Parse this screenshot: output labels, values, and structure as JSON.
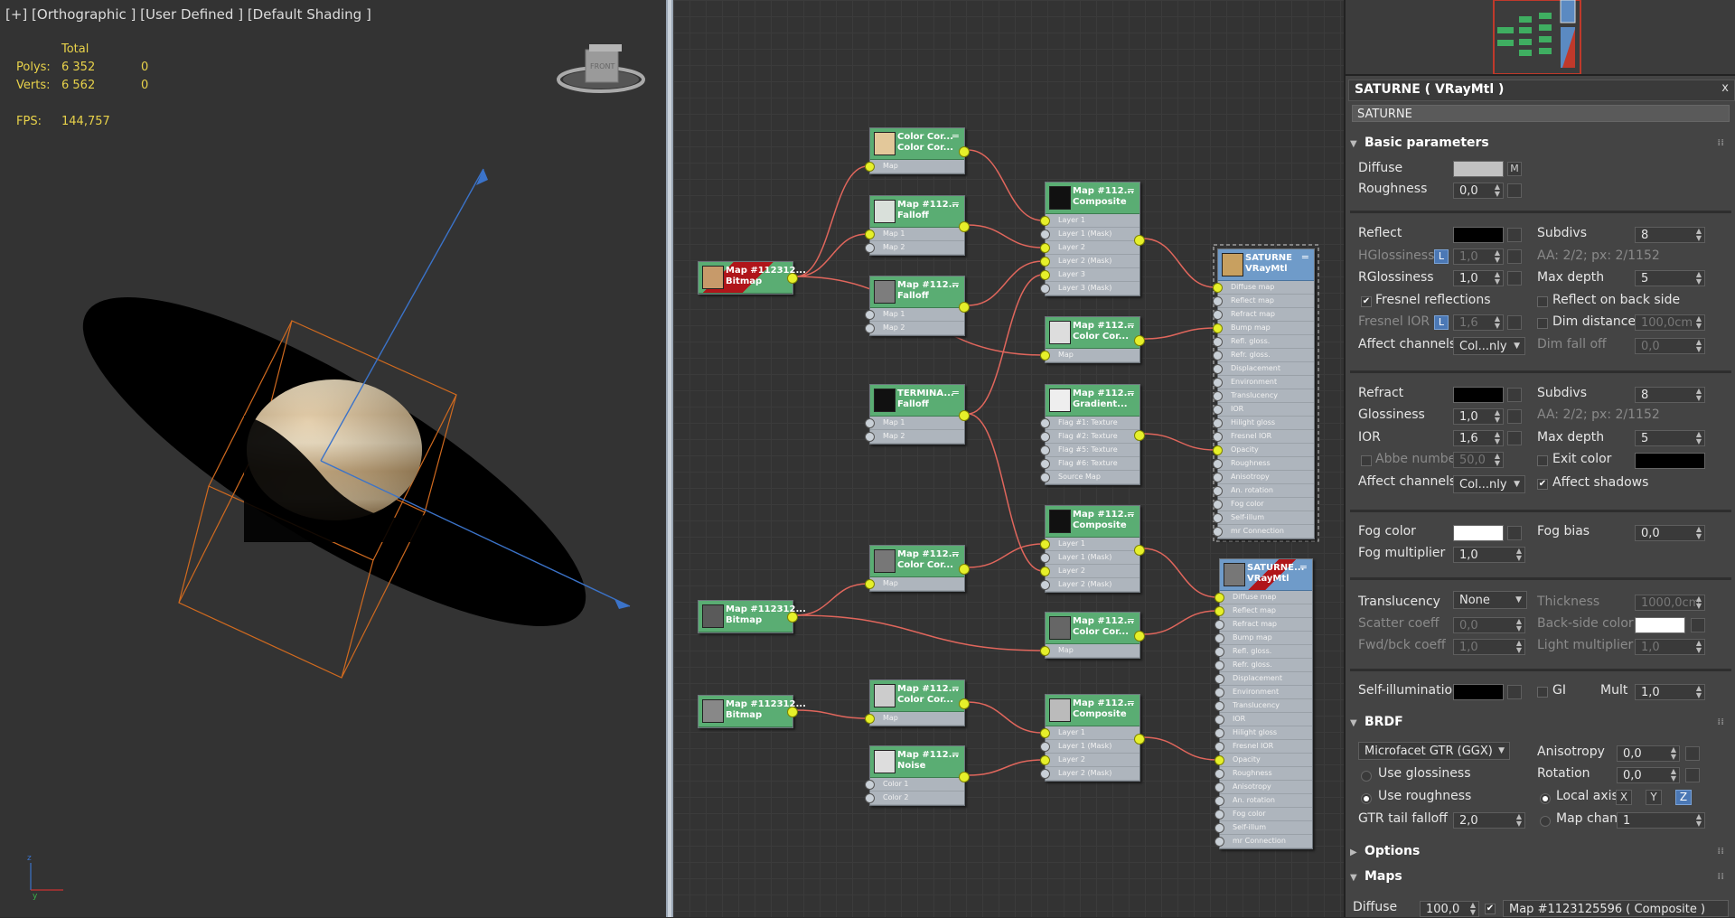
{
  "viewport": {
    "header": "[+] [Orthographic ] [User Defined ] [Default Shading ]",
    "stats": {
      "total_label": "Total",
      "polys_label": "Polys:",
      "polys_total": "6 352",
      "polys_sel": "0",
      "verts_label": "Verts:",
      "verts_total": "6 562",
      "verts_sel": "0",
      "fps_label": "FPS:",
      "fps_value": "144,757"
    },
    "viewcube_label": "FRONT"
  },
  "slate": {
    "nodes": [
      {
        "id": "n1",
        "t1": "Map #112312...",
        "t2": "Bitmap",
        "thumb": "#c79a6a",
        "red": true,
        "rows": []
      },
      {
        "id": "n2",
        "t1": "Map #112312...",
        "t2": "Bitmap",
        "thumb": "#5a5a5a",
        "rows": []
      },
      {
        "id": "n3",
        "t1": "Map #112312...",
        "t2": "Bitmap",
        "thumb": "#888",
        "rows": []
      },
      {
        "id": "n4",
        "t1": "Color Cor...",
        "t2": "Color Cor...",
        "thumb": "#e3c89a",
        "rows": [
          "Map"
        ]
      },
      {
        "id": "n5",
        "t1": "Map #112...",
        "t2": "Falloff",
        "thumb": "#d9e0da",
        "rows": [
          "Map 1",
          "Map 2"
        ]
      },
      {
        "id": "n6",
        "t1": "Map #112...",
        "t2": "Falloff",
        "thumb": "#7d7d7d",
        "rows": [
          "Map 1",
          "Map 2"
        ]
      },
      {
        "id": "n7",
        "t1": "TERMINA...",
        "t2": "Falloff",
        "thumb": "#111",
        "rows": [
          "Map 1",
          "Map 2"
        ]
      },
      {
        "id": "n8",
        "t1": "Map #112...",
        "t2": "Color Cor...",
        "thumb": "#777",
        "rows": [
          "Map"
        ]
      },
      {
        "id": "n9",
        "t1": "Map #112...",
        "t2": "Color Cor...",
        "thumb": "#ccc",
        "rows": [
          "Map"
        ]
      },
      {
        "id": "n10",
        "t1": "Map #112...",
        "t2": "Noise",
        "thumb": "#ddd",
        "rows": [
          "Color 1",
          "Color 2"
        ]
      },
      {
        "id": "n11",
        "t1": "Map #112...",
        "t2": "Composite",
        "thumb": "#111",
        "rows": [
          "Layer 1",
          "Layer 1 (Mask)",
          "Layer 2",
          "Layer 2 (Mask)",
          "Layer 3",
          "Layer 3 (Mask)"
        ]
      },
      {
        "id": "n12",
        "t1": "Map #112...",
        "t2": "Color Cor...",
        "thumb": "#ddd",
        "rows": [
          "Map"
        ]
      },
      {
        "id": "n13",
        "t1": "Map #112...",
        "t2": "Gradient...",
        "thumb": "#eee",
        "rows": [
          "Flag #1: Texture",
          "Flag #2: Texture",
          "Flag #5: Texture",
          "Flag #6: Texture",
          "Source Map"
        ]
      },
      {
        "id": "n14",
        "t1": "Map #112...",
        "t2": "Composite",
        "thumb": "#111",
        "rows": [
          "Layer 1",
          "Layer 1 (Mask)",
          "Layer 2",
          "Layer 2 (Mask)"
        ]
      },
      {
        "id": "n15",
        "t1": "Map #112...",
        "t2": "Color Cor...",
        "thumb": "#666",
        "rows": [
          "Map"
        ]
      },
      {
        "id": "n16",
        "t1": "Map #112...",
        "t2": "Composite",
        "thumb": "#bbb",
        "rows": [
          "Layer 1",
          "Layer 1 (Mask)",
          "Layer 2",
          "Layer 2 (Mask)"
        ]
      },
      {
        "id": "m1",
        "t1": "SATURNE",
        "t2": "VRayMtl",
        "thumb": "#c8a060",
        "blue": true,
        "rows": [
          "Diffuse map",
          "Reflect map",
          "Refract map",
          "Bump map",
          "Refl. gloss.",
          "Refr. gloss.",
          "Displacement",
          "Environment",
          "Translucency",
          "IOR",
          "Hilight gloss",
          "Fresnel IOR",
          "Opacity",
          "Roughness",
          "Anisotropy",
          "An. rotation",
          "Fog color",
          "Self-illum",
          "mr Connection"
        ]
      },
      {
        "id": "m2",
        "t1": "SATURNE...",
        "t2": "VRayMtl",
        "thumb": "#777",
        "blue": true,
        "red": true,
        "rows": [
          "Diffuse map",
          "Reflect map",
          "Refract map",
          "Bump map",
          "Refl. gloss.",
          "Refr. gloss.",
          "Displacement",
          "Environment",
          "Translucency",
          "IOR",
          "Hilight gloss",
          "Fresnel IOR",
          "Opacity",
          "Roughness",
          "Anisotropy",
          "An. rotation",
          "Fog color",
          "Self-illum",
          "mr Connection"
        ]
      }
    ]
  },
  "panel": {
    "title": "SATURNE  ( VRayMtl )",
    "close": "x",
    "name": "SATURNE",
    "basic": {
      "header": "Basic parameters",
      "diffuse": "Diffuse",
      "diffuse_m": "M",
      "roughness": "Roughness",
      "roughness_v": "0,0",
      "reflect": "Reflect",
      "subdivs": "Subdivs",
      "subdivs_v": "8",
      "hgloss": "HGlossiness",
      "hgloss_v": "1,0",
      "aa": "AA: 2/2; px: 2/1152",
      "rgloss": "RGlossiness",
      "rgloss_v": "1,0",
      "maxdepth": "Max depth",
      "maxdepth_v": "5",
      "fresnel": "Fresnel reflections",
      "reflect_back": "Reflect on back side",
      "fresnel_ior": "Fresnel IOR",
      "fresnel_ior_v": "1,6",
      "dimdist": "Dim distance",
      "dimdist_v": "100,0cm",
      "affect": "Affect channels",
      "affect_v": "Col...nly",
      "dimfall": "Dim fall off",
      "dimfall_v": "0,0",
      "refract": "Refract",
      "r_subdivs_v": "8",
      "glossiness": "Glossiness",
      "glossiness_v": "1,0",
      "r_aa": "AA: 2/2; px: 2/1152",
      "ior": "IOR",
      "ior_v": "1,6",
      "r_maxdepth_v": "5",
      "abbe": "Abbe number",
      "abbe_v": "50,0",
      "exitcolor": "Exit color",
      "r_affect_v": "Col...nly",
      "affect_shadows": "Affect shadows",
      "fogcolor": "Fog color",
      "fogbias": "Fog bias",
      "fogbias_v": "0,0",
      "fogmult": "Fog multiplier",
      "fogmult_v": "1,0",
      "translucency": "Translucency",
      "transl_v": "None",
      "thickness": "Thickness",
      "thickness_v": "1000,0cm",
      "scatter": "Scatter coeff",
      "scatter_v": "0,0",
      "backside": "Back-side color",
      "fwdbck": "Fwd/bck coeff",
      "fwdbck_v": "1,0",
      "lightmult": "Light multiplier",
      "lightmult_v": "1,0",
      "selfillum": "Self-illumination",
      "gi": "GI",
      "mult": "Mult",
      "mult_v": "1,0"
    },
    "brdf": {
      "header": "BRDF",
      "type_v": "Microfacet GTR (GGX)",
      "aniso": "Anisotropy",
      "aniso_v": "0,0",
      "useglossiness": "Use glossiness",
      "rotation": "Rotation",
      "rotation_v": "0,0",
      "useroughness": "Use roughness",
      "localaxis": "Local axis",
      "x": "X",
      "y": "Y",
      "z": "Z",
      "gtr": "GTR tail falloff",
      "gtr_v": "2,0",
      "mapchannel": "Map channel",
      "mapchannel_v": "1"
    },
    "options": {
      "header": "Options"
    },
    "maps": {
      "header": "Maps",
      "diffuse": "Diffuse",
      "diffuse_v": "100,0",
      "diffuse_map": "Map #1123125596  ( Composite )"
    },
    "lbtn": "L"
  },
  "colors": {
    "node_green": "#5aad73",
    "node_blue": "#6f9bc9",
    "wire": "#e0665c",
    "socket": "#e6f02a"
  }
}
